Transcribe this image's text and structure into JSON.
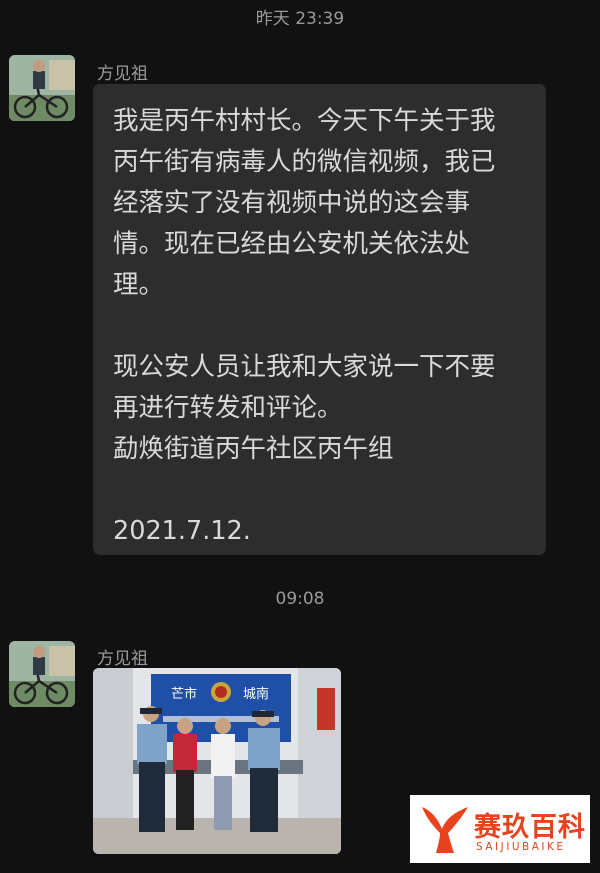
{
  "timestamps": [
    "昨天 23:39",
    "09:08"
  ],
  "messages": [
    {
      "sender": "方见祖",
      "lines": [
        "我是丙午村村长。今天下午关于我",
        "丙午街有病毒人的微信视频，我已",
        "经落实了没有视频中说的这会事",
        "情。现在已经由公安机关依法处",
        "理。",
        "",
        "现公安人员让我和大家说一下不要",
        "再进行转发和评论。",
        "勐焕街道丙午社区丙午组",
        "",
        "2021.7.12."
      ]
    },
    {
      "sender": "方见祖",
      "image": {
        "sign_text": [
          "芒市",
          "城南"
        ]
      }
    }
  ],
  "watermark": {
    "title": "赛玖百科",
    "subtitle": "SAIJIUBAIKE",
    "color": "#e8431e"
  }
}
